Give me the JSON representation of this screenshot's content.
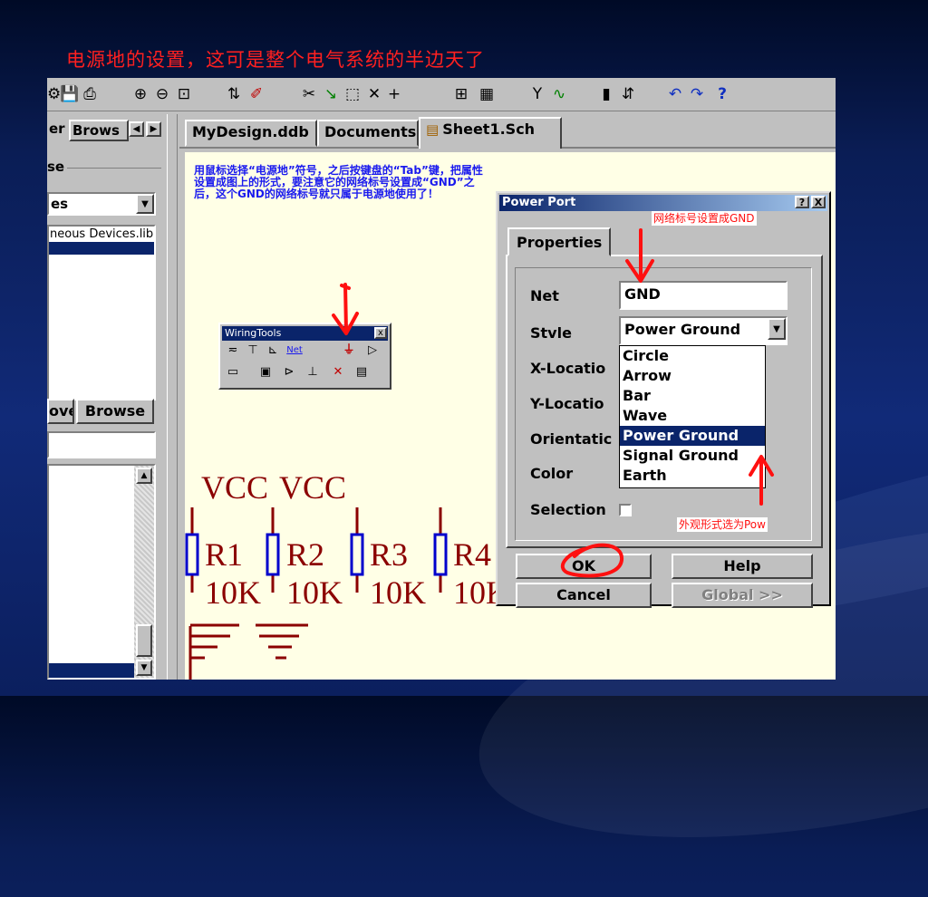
{
  "slide": {
    "title": "电源地的设置，这可是整个电气系统的半边天了"
  },
  "left_panel": {
    "tab_partial": "er",
    "tab_browse": "Brows",
    "section_partial": "se",
    "combo_value": "es",
    "library_item": "neous Devices.lib",
    "button_left": "ove",
    "button_browse": "Browse"
  },
  "doc_tabs": [
    "MyDesign.ddb",
    "Documents",
    "Sheet1.Sch"
  ],
  "instructions": "用鼠标选择“电源地”符号，之后按键盘的“Tab”键，把属性设置成图上的形式，要注意它的网络标号设置成“GND”之后，这个GND的网络标号就只属于电源地使用了！",
  "wiring_tools": {
    "title": "WiringTools",
    "net_label": "Net"
  },
  "schematic": {
    "vcc_labels": [
      "VCC",
      "VCC"
    ],
    "resistors": [
      {
        "ref": "R1",
        "value": "10K"
      },
      {
        "ref": "R2",
        "value": "10K"
      },
      {
        "ref": "R3",
        "value": "10K"
      },
      {
        "ref": "R4",
        "value": "10K"
      }
    ]
  },
  "power_port": {
    "title": "Power Port",
    "help_btn": "?",
    "close_btn": "X",
    "tab": "Properties",
    "labels": {
      "net": "Net",
      "style": "Stvle",
      "x": "X-Locatio",
      "y": "Y-Locatio",
      "orientation": "Orientatic",
      "color": "Color",
      "selection": "Selection"
    },
    "net_value": "GND",
    "style_value": "Power Ground",
    "style_options": [
      "Circle",
      "Arrow",
      "Bar",
      "Wave",
      "Power Ground",
      "Signal Ground",
      "Earth"
    ],
    "selected_option_index": 4,
    "buttons": {
      "ok": "OK",
      "help": "Help",
      "cancel": "Cancel",
      "global": "Global >>"
    }
  },
  "annotations": {
    "net_note": "网络标号设置成GND",
    "style_note": "外观形式选为Pow"
  },
  "colors": {
    "slide_title": "#ff2020",
    "instructions": "#1a1aee",
    "annotation": "#ff1010",
    "selection": "#0a246a",
    "schematic_text": "#8b0000",
    "schematic_wire": "#8b0000",
    "resistor_body": "#0000cc"
  },
  "icons": [
    "undo-icon",
    "redo-icon",
    "help-icon",
    "zoom-in-icon",
    "zoom-out-icon",
    "save-icon",
    "print-icon"
  ]
}
